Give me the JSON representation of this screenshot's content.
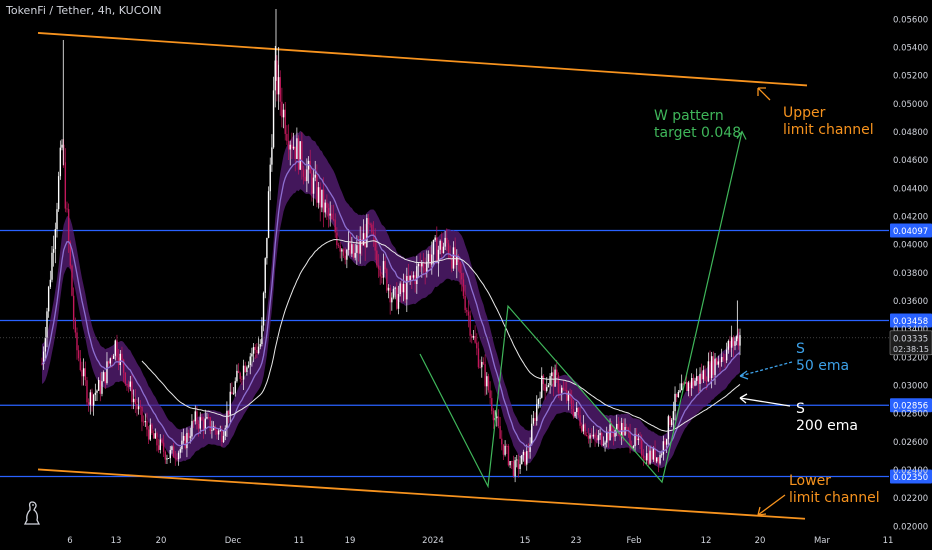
{
  "header": {
    "title": "TokenFi / Tether, 4h, KUCOIN"
  },
  "price_tags": {
    "last": "0.03335",
    "countdown": "02:38:15"
  },
  "colors": {
    "background": "#000000",
    "channel": "#f7931e",
    "support_resistance": "#2962ff",
    "up_candle": "#ffffff",
    "down_candle": "#c2185b",
    "ema50": "#8d6fd1",
    "ema_band": "#5a1f7a",
    "ema200": "#e8e8e8",
    "w_pattern": "#3fb65a",
    "annotation_blue": "#3da1e8",
    "annotation_white": "#ffffff",
    "axis_text": "#d1d4dc"
  },
  "icons": {
    "logo": "tradingview-dino-icon"
  },
  "chart_data": {
    "type": "candlestick",
    "symbol": "TokenFi / Tether",
    "timeframe": "4h",
    "exchange": "KUCOIN",
    "y_axis": {
      "ticks": [
        "0.05600",
        "0.05400",
        "0.05200",
        "0.05000",
        "0.04800",
        "0.04600",
        "0.04400",
        "0.04200",
        "0.04000",
        "0.03800",
        "0.03600",
        "0.03400",
        "0.03200",
        "0.03000",
        "0.02800",
        "0.02600",
        "0.02400",
        "0.02200",
        "0.02000"
      ],
      "range": [
        0.0197,
        0.0567
      ]
    },
    "x_axis": {
      "ticks": [
        "6",
        "13",
        "20",
        "Dec",
        "11",
        "19",
        "2024",
        "15",
        "23",
        "Feb",
        "12",
        "20",
        "Mar",
        "11"
      ]
    },
    "horizontal_levels": [
      {
        "price": 0.04097,
        "label": "0.04097"
      },
      {
        "price": 0.03458,
        "label": "0.03458"
      },
      {
        "price": 0.02856,
        "label": "0.02856"
      },
      {
        "price": 0.0235,
        "label": "0.02350"
      }
    ],
    "channel": {
      "upper": {
        "from": {
          "x": "Nov 2",
          "price": 0.055
        },
        "to": {
          "x": "Feb 20",
          "price": 0.0512
        }
      },
      "lower": {
        "from": {
          "x": "Nov 2",
          "price": 0.024
        },
        "to": {
          "x": "Feb 27",
          "price": 0.0205
        }
      }
    },
    "w_pattern": {
      "points": [
        {
          "x": "Dec 24",
          "price": 0.0322
        },
        {
          "x": "Jan 8",
          "price": 0.0228
        },
        {
          "x": "Jan 11",
          "price": 0.0356
        },
        {
          "x": "Feb 6",
          "price": 0.0231
        },
        {
          "x": "Feb 16",
          "price": 0.048
        }
      ]
    },
    "annotations": [
      {
        "text": "W pattern\ntarget 0.048"
      },
      {
        "text": "Upper\nlimit channel"
      },
      {
        "text": "S\n50 ema"
      },
      {
        "text": "S\n200 ema"
      },
      {
        "text": "Lower\nlimit channel"
      }
    ],
    "price_path": [
      [
        0,
        0.0315
      ],
      [
        3,
        0.047
      ],
      [
        5,
        0.033
      ],
      [
        7,
        0.029
      ],
      [
        9,
        0.03
      ],
      [
        11,
        0.033
      ],
      [
        13,
        0.03
      ],
      [
        15,
        0.0275
      ],
      [
        17,
        0.026
      ],
      [
        19,
        0.025
      ],
      [
        21,
        0.0255
      ],
      [
        23,
        0.0275
      ],
      [
        25,
        0.0272
      ],
      [
        27,
        0.0265
      ],
      [
        29,
        0.03
      ],
      [
        31,
        0.032
      ],
      [
        33,
        0.033
      ],
      [
        35,
        0.052
      ],
      [
        37,
        0.048
      ],
      [
        39,
        0.046
      ],
      [
        41,
        0.044
      ],
      [
        43,
        0.042
      ],
      [
        45,
        0.04
      ],
      [
        47,
        0.039
      ],
      [
        49,
        0.041
      ],
      [
        51,
        0.0385
      ],
      [
        53,
        0.036
      ],
      [
        55,
        0.037
      ],
      [
        57,
        0.0385
      ],
      [
        59,
        0.0395
      ],
      [
        61,
        0.04
      ],
      [
        63,
        0.0375
      ],
      [
        65,
        0.033
      ],
      [
        67,
        0.03
      ],
      [
        69,
        0.026
      ],
      [
        71,
        0.024
      ],
      [
        73,
        0.025
      ],
      [
        75,
        0.03
      ],
      [
        77,
        0.0305
      ],
      [
        79,
        0.029
      ],
      [
        81,
        0.0275
      ],
      [
        83,
        0.026
      ],
      [
        85,
        0.0265
      ],
      [
        87,
        0.027
      ],
      [
        89,
        0.026
      ],
      [
        91,
        0.025
      ],
      [
        93,
        0.025
      ],
      [
        95,
        0.0285
      ],
      [
        97,
        0.03
      ],
      [
        99,
        0.0305
      ],
      [
        101,
        0.0315
      ],
      [
        103,
        0.0325
      ],
      [
        105,
        0.0335
      ]
    ]
  }
}
